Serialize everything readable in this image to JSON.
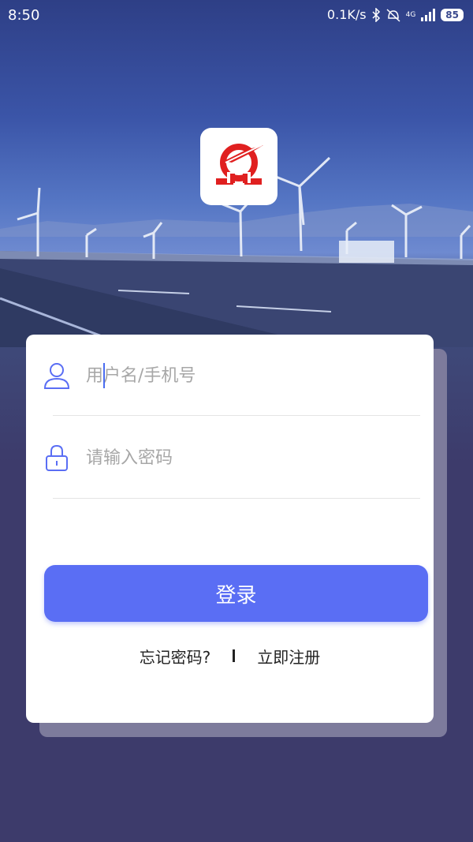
{
  "status_bar": {
    "time": "8:50",
    "network_speed": "0.1K/s",
    "network_type": "4G",
    "battery": "85",
    "icons": [
      "bluetooth-icon",
      "alarm-off-icon",
      "signal-icon",
      "battery-icon"
    ]
  },
  "app": {
    "logo_icon": "omega-railway-logo",
    "logo_color": "#e02020"
  },
  "login_form": {
    "username_placeholder": "用户名/手机号",
    "password_placeholder": "请输入密码",
    "login_label": "登录",
    "forgot_password_label": "忘记密码?",
    "register_label": "立即注册",
    "accent_color": "#5a6ef4"
  }
}
